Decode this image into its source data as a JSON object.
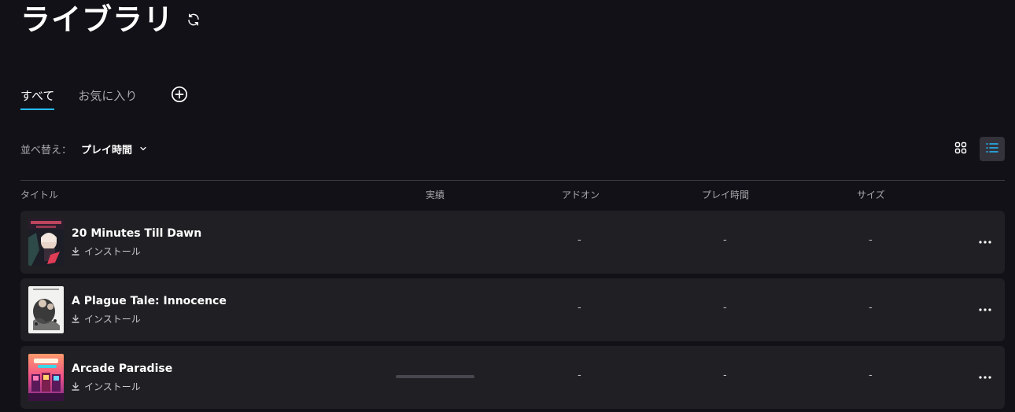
{
  "header": {
    "title": "ライブラリ",
    "refresh_icon": "refresh-icon"
  },
  "tabs": [
    {
      "label": "すべて",
      "active": true
    },
    {
      "label": "お気に入り",
      "active": false
    }
  ],
  "add_collection_icon": "plus-circle-icon",
  "sort": {
    "label": "並べ替え：",
    "value": "プレイ時間"
  },
  "view_modes": {
    "grid_icon": "grid-view-icon",
    "list_icon": "list-view-icon",
    "selected": "list"
  },
  "columns": {
    "title": "タイトル",
    "achievements": "実績",
    "addons": "アドオン",
    "playtime": "プレイ時間",
    "size": "サイズ"
  },
  "accent_color": "#26bbff",
  "games": [
    {
      "name": "20 Minutes Till Dawn",
      "install_label": "インストール",
      "addons": "-",
      "playtime": "-",
      "size": "-"
    },
    {
      "name": "A Plague Tale: Innocence",
      "install_label": "インストール",
      "addons": "-",
      "playtime": "-",
      "size": "-"
    },
    {
      "name": "Arcade Paradise",
      "install_label": "インストール",
      "addons": "-",
      "playtime": "-",
      "size": "-",
      "achievement_progress": 0
    }
  ]
}
